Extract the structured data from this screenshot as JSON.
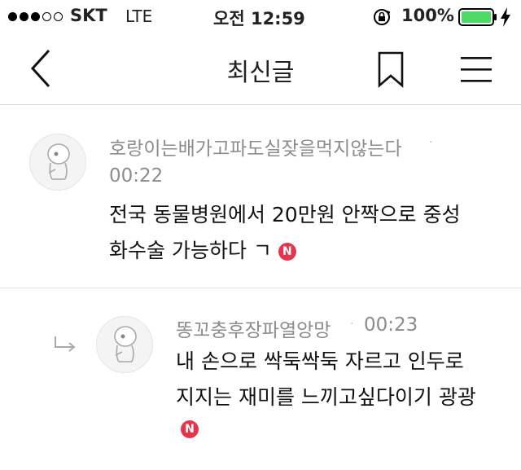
{
  "status_bar": {
    "signal_dots_filled": 3,
    "signal_dots_total": 5,
    "carrier": "SKT",
    "network": "LTE",
    "time": "오전 12:59",
    "battery": "100%",
    "battery_color": "#4cd964"
  },
  "nav": {
    "title": "최신글",
    "back_icon": "chevron-left-icon",
    "bookmark_icon": "bookmark-icon",
    "menu_icon": "hamburger-menu-icon"
  },
  "comments": [
    {
      "nickname": "호랑이는배가고파도실잦을먹지않는다",
      "separator": "·",
      "time": "00:22",
      "text_line1": "전국 동물병원에서 20만원 안짝으로 중성",
      "text_line2": "화수술 가능하다 ㄱ",
      "badge": "N"
    },
    {
      "nickname": "똥꼬충후장파열앙망",
      "separator": "·",
      "time": "00:23",
      "text_line1": "내 손으로 싹둑싹둑 자르고 인두로",
      "text_line2": "지지는 재미를 느끼고싶다이기 광광",
      "badge": "N",
      "is_reply": true
    }
  ],
  "colors": {
    "badge": "#e6344a",
    "meta_text": "#8c8c8c"
  }
}
